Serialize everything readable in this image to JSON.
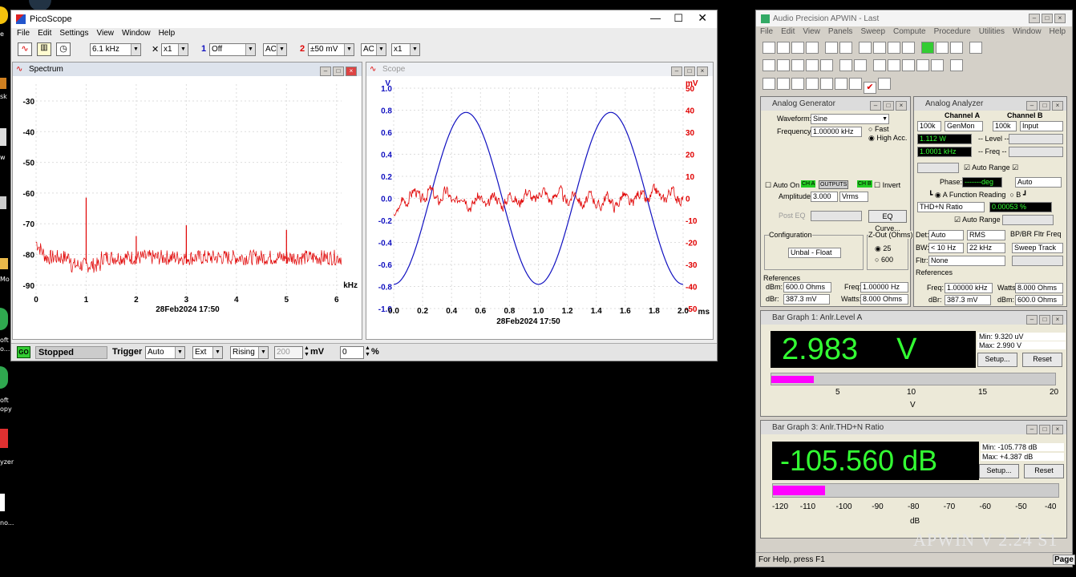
{
  "desktop": {
    "labels": [
      "e",
      "sk",
      "w",
      "Mo",
      "oft",
      "o...",
      "oft",
      "opy",
      "yzer",
      "no..."
    ]
  },
  "pico": {
    "title": "PicoScope",
    "menu": [
      "File",
      "Edit",
      "Settings",
      "View",
      "Window",
      "Help"
    ],
    "toolbar": {
      "freq": "6.1 kHz",
      "x_mult": "x1",
      "ch1_num": "1",
      "ch1_range": "Off",
      "ch1_coupling": "AC",
      "ch2_num": "2",
      "ch2_range": "±50 mV",
      "ch2_coupling": "AC",
      "ch2_mult": "x1"
    },
    "spectrum": {
      "title": "Spectrum",
      "y_ticks": [
        "-30",
        "-40",
        "-50",
        "-60",
        "-70",
        "-80",
        "-90"
      ],
      "x_ticks": [
        "0",
        "1",
        "2",
        "3",
        "4",
        "5",
        "6"
      ],
      "x_unit": "kHz",
      "timestamp": "28Feb2024  17:50"
    },
    "scope": {
      "title": "Scope",
      "left_unit": "V",
      "right_unit": "mV",
      "left_ticks": [
        "1.0",
        "0.8",
        "0.6",
        "0.4",
        "0.2",
        "0.0",
        "-0.2",
        "-0.4",
        "-0.6",
        "-0.8",
        "-1.0"
      ],
      "right_ticks": [
        "50",
        "40",
        "30",
        "20",
        "10",
        "0",
        "-10",
        "-20",
        "-30",
        "-40",
        "-50"
      ],
      "x_ticks": [
        "0.0",
        "0.2",
        "0.4",
        "0.6",
        "0.8",
        "1.0",
        "1.2",
        "1.4",
        "1.6",
        "1.8",
        "2.0"
      ],
      "x_unit": "ms",
      "timestamp": "28Feb2024  17:50"
    },
    "status": {
      "go": "GO",
      "state": "Stopped",
      "trigger_label": "Trigger",
      "trigger_mode": "Auto",
      "trigger_source": "Ext",
      "trigger_edge": "Rising",
      "trigger_level": "200",
      "level_unit": "mV",
      "pretrigger": "0",
      "pretrigger_unit": "%"
    },
    "colors": {
      "spectrum": "#e00000",
      "ch1": "#1010c0",
      "ch2": "#e00000"
    }
  },
  "ap": {
    "title": "Audio Precision APWIN - Last",
    "menu": [
      "File",
      "Edit",
      "View",
      "Panels",
      "Sweep",
      "Compute",
      "Procedure",
      "Utilities",
      "Window",
      "Help"
    ],
    "generator": {
      "title": "Analog Generator",
      "waveform_label": "Waveform:",
      "waveform": "Sine",
      "frequency_label": "Frequency:",
      "frequency": "1.00000 kHz",
      "fast": "Fast",
      "high_acc": "High Acc.",
      "auto_on": "Auto On",
      "cha": "CH A",
      "outputs": "OUTPUTS",
      "chb": "CH B",
      "invert": "Invert",
      "amplitude_label": "Amplitude:",
      "amplitude": "3.000",
      "amplitude_unit": "Vrms",
      "post_eq": "Post EQ",
      "eq_curve": "EQ Curve...",
      "config_label": "Configuration",
      "config": "Unbal - Float",
      "zout_label": "Z-Out (Ohms)",
      "z25": "25",
      "z600": "600",
      "references": "References",
      "dbm_label": "dBm:",
      "dbm": "600.0",
      "dbm_unit": "Ohms",
      "freq_label": "Freq:",
      "freq": "1.00000 Hz",
      "dbr_label": "dBr:",
      "dbr": "387.3",
      "dbr_unit": "mV",
      "watts_label": "Watts:",
      "watts": "8.000",
      "watts_unit": "Ohms"
    },
    "analyzer": {
      "title": "Analog Analyzer",
      "cha": "Channel A",
      "chb": "Channel B",
      "a_range": "100k",
      "a_input": "GenMon",
      "b_range": "100k",
      "b_input": "Input",
      "level_a": "1.112  W",
      "level_label": "-- Level --",
      "freq_a": "1.0001 kHz",
      "freq_label": "-- Freq --",
      "auto_range": "Auto Range",
      "phase_label": "Phase:",
      "phase_value": "-------deg",
      "phase_mode": "Auto",
      "a_label": "A",
      "function_reading": "Function Reading",
      "b_label": "B",
      "func": "THD+N Ratio",
      "func_value": "0.00053  %",
      "auto_range2": "Auto Range",
      "det_label": "Det:",
      "det": "Auto",
      "rms": "RMS",
      "bpbr": "BP/BR Fltr Freq",
      "bw_label": "BW:",
      "bw_lo": "< 10 Hz",
      "bw_hi": "22 kHz",
      "sweep_track": "Sweep Track",
      "fltr_label": "Fltr:",
      "fltr": "None",
      "references": "References",
      "freq_ref_label": "Freq:",
      "freq_ref": "1.00000 kHz",
      "watts_label": "Watts:",
      "watts": "8.000",
      "watts_unit": "Ohms",
      "dbr_label": "dBr:",
      "dbr": "387.3",
      "dbr_unit": "mV",
      "dbm_label": "dBm:",
      "dbm": "600.0",
      "dbm_unit": "Ohms"
    },
    "bar1": {
      "title": "Bar Graph 1: Anlr.Level A",
      "value": "2.983",
      "unit": "V",
      "min": "Min: 9.320   uV",
      "max": "Max: 2.990   V",
      "setup": "Setup...",
      "reset": "Reset",
      "ticks": [
        "5",
        "10",
        "15",
        "20"
      ],
      "axis_unit": "V",
      "scale_max": 20,
      "level": 2.983
    },
    "bar3": {
      "title": "Bar Graph 3: Anlr.THD+N Ratio",
      "value": "-105.560 dB",
      "min": "Min: -105.778 dB",
      "max": "Max: +4.387   dB",
      "setup": "Setup...",
      "reset": "Reset",
      "ticks": [
        "-120",
        "-110",
        "-100",
        "-90",
        "-80",
        "-70",
        "-60",
        "-50",
        "-40"
      ],
      "axis_unit": "dB",
      "scale_min": -120,
      "scale_max": -40,
      "level": -105.56
    },
    "watermark": "APWIN V 2.24  S1",
    "status": "For Help, press F1",
    "page_tab": "Page"
  }
}
